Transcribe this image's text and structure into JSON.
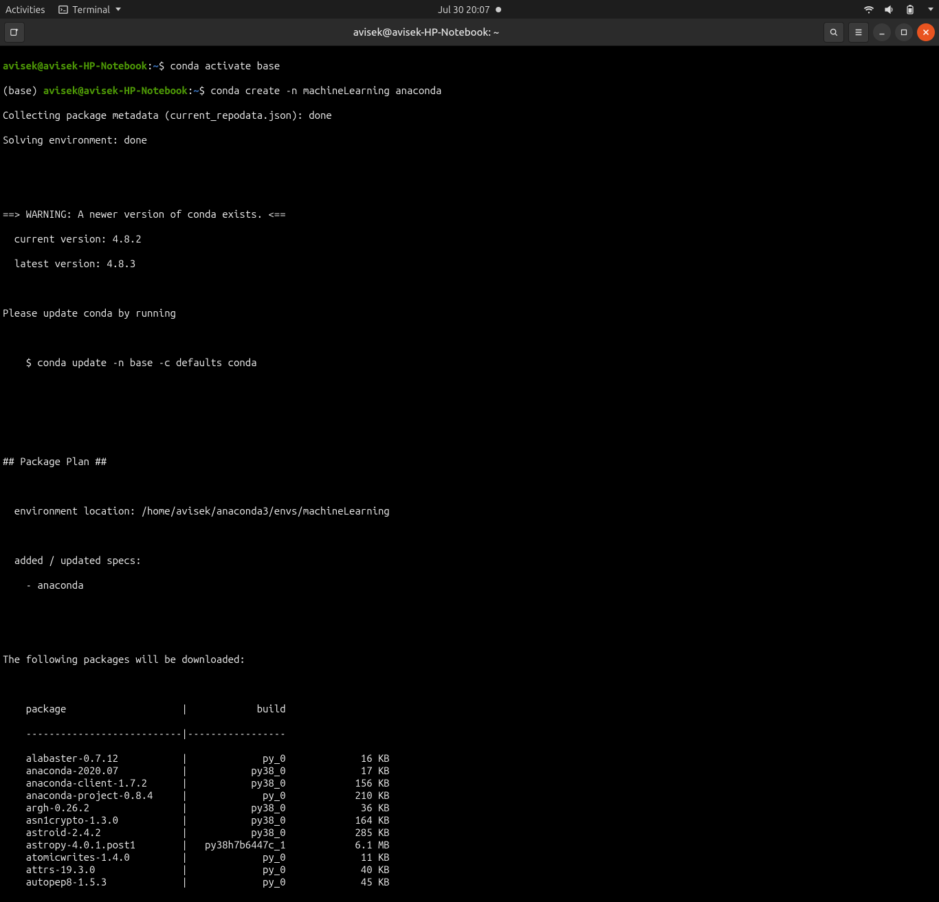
{
  "topbar": {
    "activities": "Activities",
    "app_label": "Terminal",
    "datetime": "Jul 30  20:07"
  },
  "window": {
    "title": "avisek@avisek-HP-Notebook: ~"
  },
  "prompt": {
    "userhost": "avisek@avisek-HP-Notebook",
    "sep": ":",
    "path": "~",
    "sigil": "$",
    "env_prefix": "(base) "
  },
  "cmds": {
    "c1": "conda activate base",
    "c2": "conda create -n machineLearning anaconda"
  },
  "lines": {
    "l1": "Collecting package metadata (current_repodata.json): done",
    "l2": "Solving environment: done",
    "warn_head": "==> WARNING: A newer version of conda exists. <==",
    "warn_cur": "  current version: 4.8.2",
    "warn_lat": "  latest version: 4.8.3",
    "update_hint": "Please update conda by running",
    "update_cmd": "    $ conda update -n base -c defaults conda",
    "plan_head": "## Package Plan ##",
    "env_loc": "  environment location: /home/avisek/anaconda3/envs/machineLearning",
    "specs_head": "  added / updated specs:",
    "specs_item": "    - anaconda",
    "dl_head": "The following packages will be downloaded:",
    "table_head": "    package                    |            build",
    "table_rule": "    ---------------------------|-----------------"
  },
  "packages": [
    {
      "name": "alabaster-0.7.12",
      "build": "py_0",
      "size": "16 KB"
    },
    {
      "name": "anaconda-2020.07",
      "build": "py38_0",
      "size": "17 KB"
    },
    {
      "name": "anaconda-client-1.7.2",
      "build": "py38_0",
      "size": "156 KB"
    },
    {
      "name": "anaconda-project-0.8.4",
      "build": "py_0",
      "size": "210 KB"
    },
    {
      "name": "argh-0.26.2",
      "build": "py38_0",
      "size": "36 KB"
    },
    {
      "name": "asn1crypto-1.3.0",
      "build": "py38_0",
      "size": "164 KB"
    },
    {
      "name": "astroid-2.4.2",
      "build": "py38_0",
      "size": "285 KB"
    },
    {
      "name": "astropy-4.0.1.post1",
      "build": "py38h7b6447c_1",
      "size": "6.1 MB"
    },
    {
      "name": "atomicwrites-1.4.0",
      "build": "py_0",
      "size": "11 KB"
    },
    {
      "name": "attrs-19.3.0",
      "build": "py_0",
      "size": "40 KB"
    },
    {
      "name": "autopep8-1.5.3",
      "build": "py_0",
      "size": "45 KB"
    }
  ]
}
